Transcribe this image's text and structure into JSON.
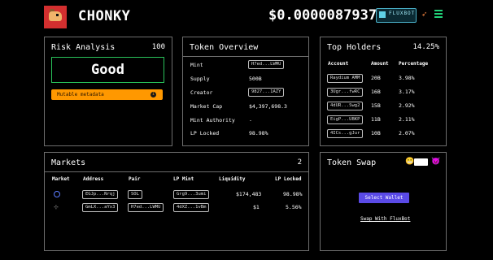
{
  "header": {
    "title": "CHONKY",
    "price": "$0.00000879373",
    "fluxbot_label": "FLUXBOT"
  },
  "risk": {
    "title": "Risk Analysis",
    "score": "100",
    "rating": "Good",
    "warning": "Mutable metadata",
    "warning_icon": "info-icon"
  },
  "overview": {
    "title": "Token Overview",
    "rows": [
      {
        "label": "Mint",
        "value": "H7ed...LWMU",
        "chip": true
      },
      {
        "label": "Supply",
        "value": "500B",
        "chip": false
      },
      {
        "label": "Creator",
        "value": "9827...1AZY",
        "chip": true
      },
      {
        "label": "Market Cap",
        "value": "$4,397,698.3",
        "chip": false
      },
      {
        "label": "Mint Authority",
        "value": "-",
        "chip": false
      },
      {
        "label": "LP Locked",
        "value": "98.98%",
        "chip": false
      }
    ]
  },
  "holders": {
    "title": "Top Holders",
    "percent": "14.25%",
    "headers": [
      "Account",
      "Amount",
      "Percentage"
    ],
    "rows": [
      {
        "account": "Raydium AMM",
        "amount": "20B",
        "pct": "3.98%"
      },
      {
        "account": "3Ugr...fwRC",
        "amount": "16B",
        "pct": "3.17%"
      },
      {
        "account": "4dUR...Swg2",
        "amount": "15B",
        "pct": "2.92%"
      },
      {
        "account": "EigP...UBKP",
        "amount": "11B",
        "pct": "2.11%"
      },
      {
        "account": "4ICs...gJur",
        "amount": "10B",
        "pct": "2.07%"
      }
    ]
  },
  "markets": {
    "title": "Markets",
    "count": "2",
    "headers": [
      "Market",
      "Address",
      "Pair",
      "LP Mint",
      "Liquidity",
      "LP Locked"
    ],
    "rows": [
      {
        "icon": "raydium-icon",
        "address": "EGJp...Nrqj",
        "pair": "SOL",
        "lp_mint": "Grg9...3umi",
        "liquidity": "$174,483",
        "locked": "98.98%"
      },
      {
        "icon": "orca-icon",
        "address": "GmLX...aYx3",
        "pair": "H7ed...LWMU",
        "lp_mint": "4dXZ...1vBm",
        "liquidity": "$1",
        "locked": "5.56%"
      }
    ]
  },
  "swap": {
    "title": "Token Swap",
    "wallet_button": "Select Wallet",
    "link": "Swap With FluxBot"
  }
}
